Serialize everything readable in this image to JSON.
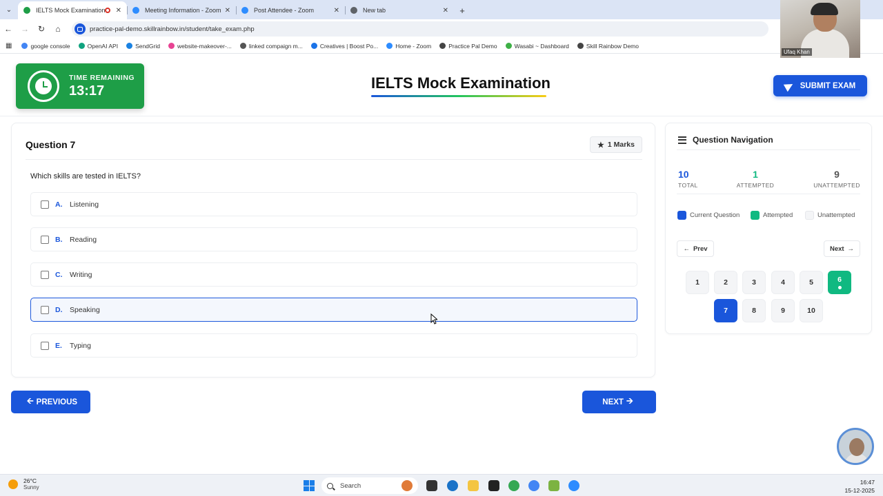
{
  "browser": {
    "tabs": [
      {
        "title": "IELTS Mock Examination",
        "active": true,
        "favicon_color": "#1e9e47"
      },
      {
        "title": "Meeting Information - Zoom",
        "active": false,
        "favicon_color": "#2d8cff"
      },
      {
        "title": "Post Attendee - Zoom",
        "active": false,
        "favicon_color": "#2d8cff"
      },
      {
        "title": "New tab",
        "active": false,
        "favicon_color": "#5f6368"
      }
    ],
    "url": "practice-pal-demo.skillrainbow.in/student/take_exam.php",
    "bookmarks": [
      {
        "label": "google console",
        "color": "#4285f4"
      },
      {
        "label": "OpenAI API",
        "color": "#10a37f"
      },
      {
        "label": "SendGrid",
        "color": "#1a82e2"
      },
      {
        "label": "website-makeover-...",
        "color": "#e84393"
      },
      {
        "label": "linked compaign m...",
        "color": "#555555"
      },
      {
        "label": "Creatives | Boost Po...",
        "color": "#1a73e8"
      },
      {
        "label": "Home - Zoom",
        "color": "#2d8cff"
      },
      {
        "label": "Practice Pal Demo",
        "color": "#444444"
      },
      {
        "label": "Wasabi ~ Dashboard",
        "color": "#3db046"
      },
      {
        "label": "Skill Rainbow Demo",
        "color": "#444444"
      }
    ]
  },
  "webcam": {
    "name": "Ufaq Khan"
  },
  "exam": {
    "timer_label": "TIME REMAINING",
    "timer_value": "13:17",
    "title": "IELTS Mock Examination",
    "submit_label": "SUBMIT EXAM"
  },
  "question": {
    "number_label": "Question 7",
    "marks_label": "1 Marks",
    "text": "Which skills are tested in IELTS?",
    "options": [
      {
        "letter": "A.",
        "text": "Listening",
        "selected": false
      },
      {
        "letter": "B.",
        "text": "Reading",
        "selected": false
      },
      {
        "letter": "C.",
        "text": "Writing",
        "selected": false
      },
      {
        "letter": "D.",
        "text": "Speaking",
        "selected": false
      },
      {
        "letter": "E.",
        "text": "Typing",
        "selected": false
      }
    ],
    "prev_label": "PREVIOUS",
    "next_label": "NEXT"
  },
  "navigation": {
    "title": "Question Navigation",
    "stats": {
      "total": {
        "value": "10",
        "label": "TOTAL",
        "color": "#1a56db"
      },
      "attempted": {
        "value": "1",
        "label": "ATTEMPTED",
        "color": "#10b981"
      },
      "unattempted": {
        "value": "9",
        "label": "UNATTEMPTED",
        "color": "#555555"
      }
    },
    "legend": {
      "current": {
        "label": "Current Question",
        "color": "#1a56db"
      },
      "attempted": {
        "label": "Attempted",
        "color": "#10b981"
      },
      "unattempted": {
        "label": "Unattempted",
        "color": "#f4f5f7"
      }
    },
    "prev_label": "Prev",
    "next_label": "Next",
    "questions": [
      "1",
      "2",
      "3",
      "4",
      "5",
      "6",
      "7",
      "8",
      "9",
      "10"
    ],
    "current_question": "7",
    "attempted_questions": [
      "6"
    ]
  },
  "taskbar": {
    "weather_temp": "26°C",
    "weather_desc": "Sunny",
    "search_label": "Search",
    "time": "16:47",
    "date": "15-12-2025"
  }
}
